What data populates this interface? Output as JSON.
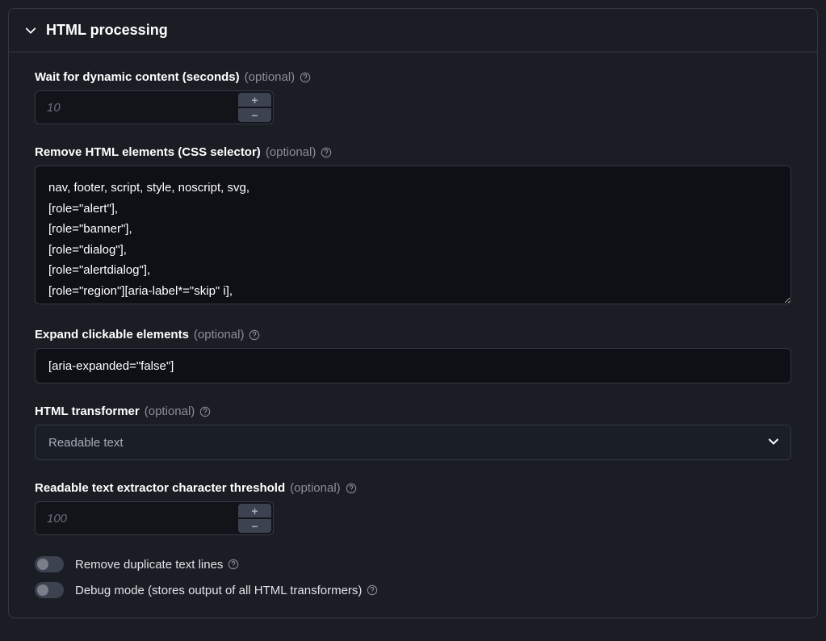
{
  "section": {
    "title": "HTML processing"
  },
  "fields": {
    "waitDynamic": {
      "label": "Wait for dynamic content (seconds)",
      "optional": "(optional)",
      "placeholder": "10"
    },
    "removeElements": {
      "label": "Remove HTML elements (CSS selector)",
      "optional": "(optional)",
      "value": "nav, footer, script, style, noscript, svg,\n[role=\"alert\"],\n[role=\"banner\"],\n[role=\"dialog\"],\n[role=\"alertdialog\"],\n[role=\"region\"][aria-label*=\"skip\" i],"
    },
    "expandClickable": {
      "label": "Expand clickable elements",
      "optional": "(optional)",
      "value": "[aria-expanded=\"false\"]"
    },
    "htmlTransformer": {
      "label": "HTML transformer",
      "optional": "(optional)",
      "value": "Readable text"
    },
    "charThreshold": {
      "label": "Readable text extractor character threshold",
      "optional": "(optional)",
      "placeholder": "100"
    },
    "removeDuplicate": {
      "label": "Remove duplicate text lines"
    },
    "debugMode": {
      "label": "Debug mode (stores output of all HTML transformers)"
    }
  }
}
